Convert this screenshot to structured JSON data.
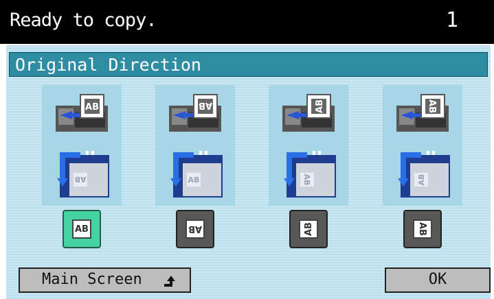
{
  "status": {
    "message": "Ready to copy.",
    "copy_count": "1"
  },
  "panel": {
    "title": "Original Direction"
  },
  "orientations": [
    {
      "glyph": "AB",
      "rotation": 0,
      "selected": true
    },
    {
      "glyph": "AB",
      "rotation": 180,
      "selected": false
    },
    {
      "glyph": "AB",
      "rotation": 90,
      "selected": false
    },
    {
      "glyph": "AB",
      "rotation": -90,
      "selected": false
    }
  ],
  "footer": {
    "main_screen_label": "Main Screen",
    "ok_label": "OK"
  },
  "colors": {
    "selected_button": "#45d3a3",
    "title_bar": "#2f8da3",
    "status_bar": "#000000"
  }
}
